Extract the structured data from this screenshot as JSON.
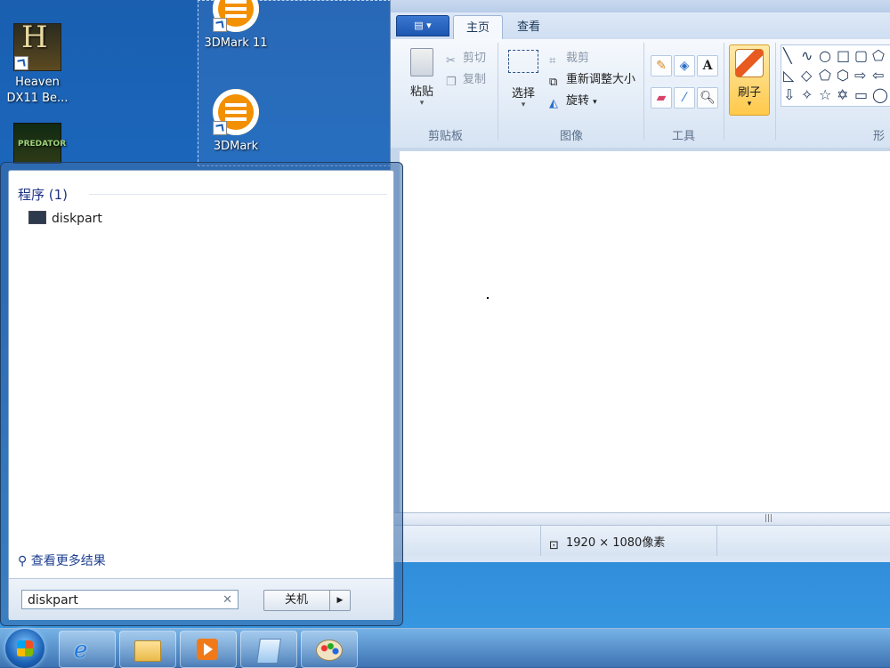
{
  "desktop": {
    "icons": [
      {
        "label": "Heaven DX11 Be..."
      },
      {
        "label": ""
      },
      {
        "label": "3DMark 11"
      },
      {
        "label": "3DMark"
      }
    ],
    "heaven_line1": "Heaven",
    "heaven_line2": "DX11 Be..."
  },
  "paint": {
    "file_menu_icon": "file-menu-icon",
    "tabs": [
      "主页",
      "查看"
    ],
    "clipboard": {
      "paste": "粘贴",
      "cut": "剪切",
      "copy": "复制",
      "group": "剪贴板"
    },
    "image": {
      "select": "选择",
      "crop": "裁剪",
      "resize": "重新调整大小",
      "rotate": "旋转",
      "group": "图像"
    },
    "tools": {
      "group": "工具",
      "text_tool": "A"
    },
    "brush": "刷子",
    "shapes_group": "形",
    "statusbar": {
      "size": "1920 × 1080像素"
    }
  },
  "startmenu": {
    "heading": "程序 (1)",
    "program": "diskpart",
    "more_results": "查看更多结果",
    "search_value": "diskpart",
    "shutdown": "关机"
  },
  "colors": {
    "accent": "#1e3287",
    "brush_highlight": "#ffc94b",
    "desktop": "#1c6cc4"
  }
}
